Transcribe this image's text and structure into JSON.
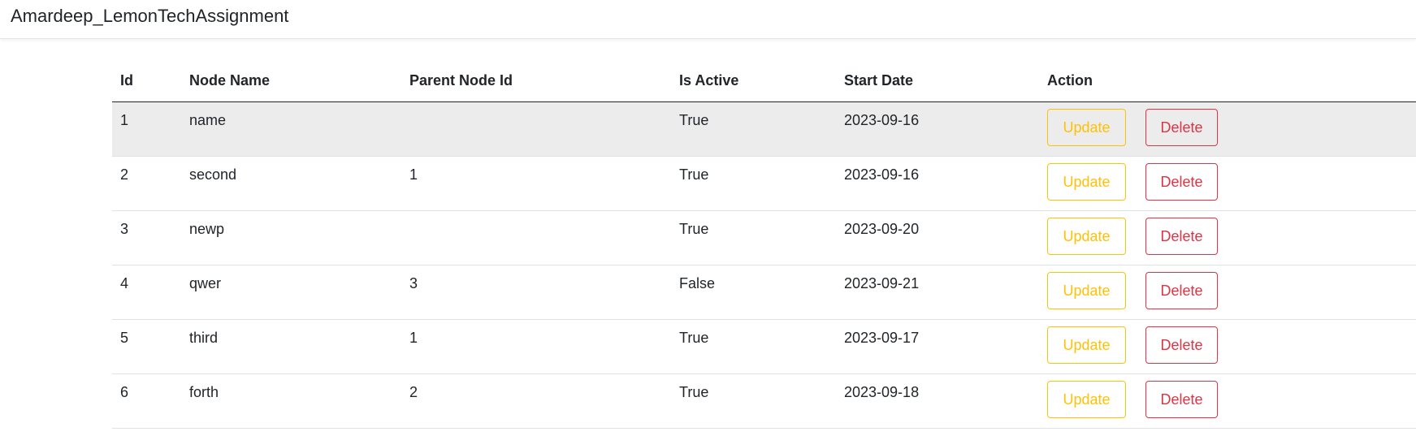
{
  "navbar": {
    "brand": "Amardeep_LemonTechAssignment"
  },
  "table": {
    "headers": {
      "id": "Id",
      "node_name": "Node Name",
      "parent_node_id": "Parent Node Id",
      "is_active": "Is Active",
      "start_date": "Start Date",
      "action": "Action"
    },
    "rows": [
      {
        "id": "1",
        "node_name": "name",
        "parent_node_id": "",
        "is_active": "True",
        "start_date": "2023-09-16",
        "update_label": "Update",
        "delete_label": "Delete"
      },
      {
        "id": "2",
        "node_name": "second",
        "parent_node_id": "1",
        "is_active": "True",
        "start_date": "2023-09-16",
        "update_label": "Update",
        "delete_label": "Delete"
      },
      {
        "id": "3",
        "node_name": "newp",
        "parent_node_id": "",
        "is_active": "True",
        "start_date": "2023-09-20",
        "update_label": "Update",
        "delete_label": "Delete"
      },
      {
        "id": "4",
        "node_name": "qwer",
        "parent_node_id": "3",
        "is_active": "False",
        "start_date": "2023-09-21",
        "update_label": "Update",
        "delete_label": "Delete"
      },
      {
        "id": "5",
        "node_name": "third",
        "parent_node_id": "1",
        "is_active": "True",
        "start_date": "2023-09-17",
        "update_label": "Update",
        "delete_label": "Delete"
      },
      {
        "id": "6",
        "node_name": "forth",
        "parent_node_id": "2",
        "is_active": "True",
        "start_date": "2023-09-18",
        "update_label": "Update",
        "delete_label": "Delete"
      }
    ]
  },
  "colors": {
    "update_button": "#ffc107",
    "delete_button": "#dc3545",
    "striped_row": "#ececec"
  }
}
